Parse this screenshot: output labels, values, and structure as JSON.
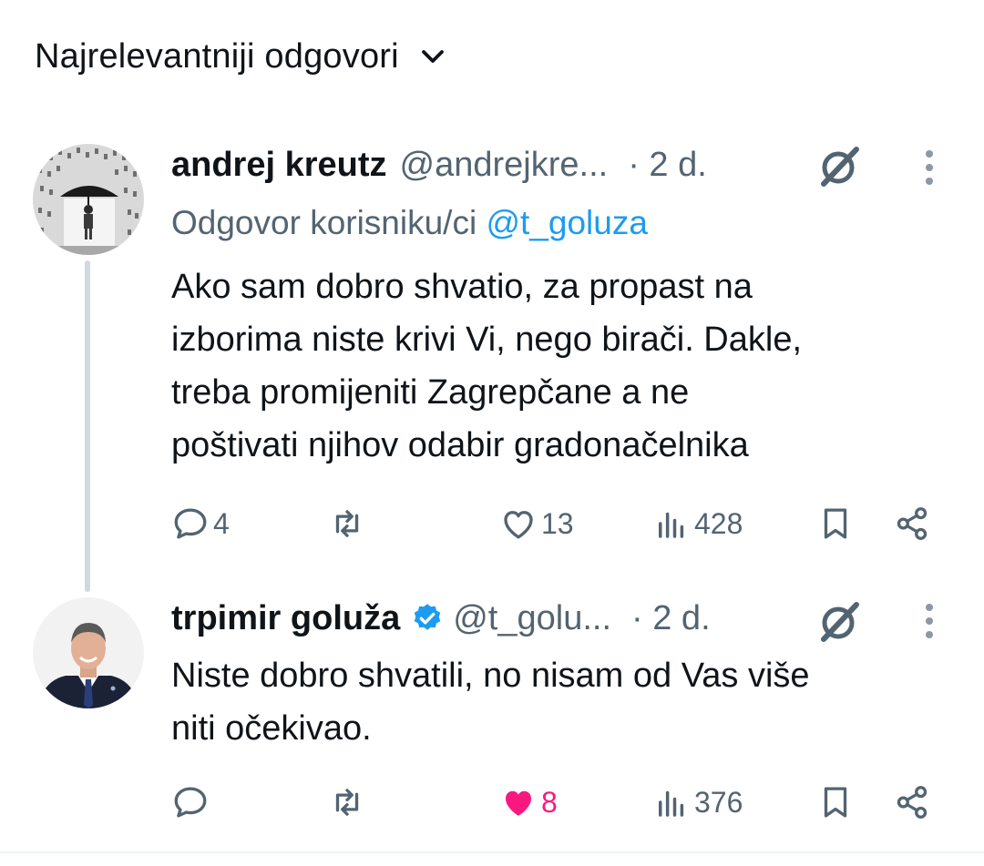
{
  "header": {
    "title": "Najrelevantniji odgovori"
  },
  "tweets": [
    {
      "name": "andrej kreutz",
      "handle": "@andrejkre...",
      "time": "· 2 d.",
      "reply_prefix": "Odgovor korisniku/ci",
      "reply_mention": "@t_goluza",
      "lines": [
        "Ako sam dobro shvatio, za propast na",
        "izborima niste krivi Vi, nego birači. Dakle,",
        "treba promijeniti Zagrepčane a ne",
        "poštivati njihov odabir gradonačelnika"
      ],
      "replies": "4",
      "reposts": "",
      "likes": "13",
      "views": "428",
      "liked": false
    },
    {
      "name": "trpimir goluža",
      "handle": "@t_golu...",
      "time": "· 2 d.",
      "verified": true,
      "lines": [
        "Niste dobro shvatili, no nisam od Vas više",
        "niti očekivao."
      ],
      "replies": "",
      "reposts": "",
      "likes": "8",
      "views": "376",
      "liked": true
    }
  ],
  "colors": {
    "text": "#0f1419",
    "secondary": "#536471",
    "link": "#1d9bf0",
    "like": "#f91880",
    "verified": "#1d9bf0",
    "thread_line": "#cfd9de"
  },
  "icons": {
    "sort": "chevron-down-icon",
    "reply": "reply-icon",
    "repost": "repost-icon",
    "like": "heart-icon",
    "views": "views-icon",
    "bookmark": "bookmark-icon",
    "share": "share-icon",
    "grok": "grok-icon",
    "more": "more-icon"
  }
}
